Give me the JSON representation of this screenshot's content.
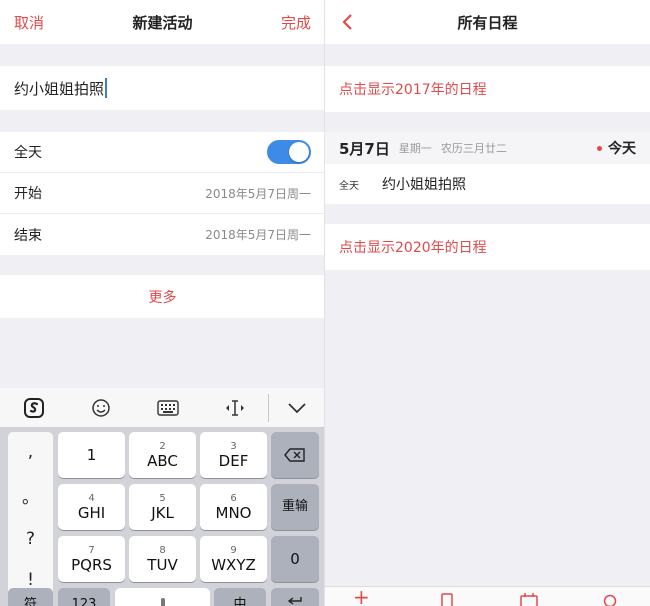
{
  "left": {
    "nav": {
      "cancel": "取消",
      "title": "新建活动",
      "done": "完成"
    },
    "title_input": {
      "value": "约小姐姐拍照"
    },
    "rows": {
      "allday_label": "全天",
      "start_label": "开始",
      "start_value": "2018年5月7日周一",
      "end_label": "结束",
      "end_value": "2018年5月7日周一"
    },
    "more": "更多",
    "keyboard": {
      "punct": [
        ",",
        "。",
        "?",
        "!"
      ],
      "keys": [
        {
          "num": "",
          "label": "1"
        },
        {
          "num": "2",
          "label": "ABC"
        },
        {
          "num": "3",
          "label": "DEF"
        },
        {
          "num": "4",
          "label": "GHI"
        },
        {
          "num": "5",
          "label": "JKL"
        },
        {
          "num": "6",
          "label": "MNO"
        },
        {
          "num": "7",
          "label": "PQRS"
        },
        {
          "num": "8",
          "label": "TUV"
        },
        {
          "num": "9",
          "label": "WXYZ"
        }
      ],
      "delete_icon": "backspace-icon",
      "enter_label": "重输",
      "zero_label": "0",
      "bottom_symbol": "符",
      "bottom_123": "123",
      "bottom_lang": "中"
    }
  },
  "right": {
    "nav": {
      "title": "所有日程"
    },
    "show_2017": "点击显示2017年的日程",
    "date_header": {
      "date": "5月7日",
      "weekday": "星期一",
      "lunar": "农历三月廿二",
      "today": "今天"
    },
    "event": {
      "allday": "全天",
      "title": "约小姐姐拍照"
    },
    "show_2020": "点击显示2020年的日程"
  },
  "colors": {
    "accent": "#e24a4a",
    "toggle": "#3d8be6"
  }
}
